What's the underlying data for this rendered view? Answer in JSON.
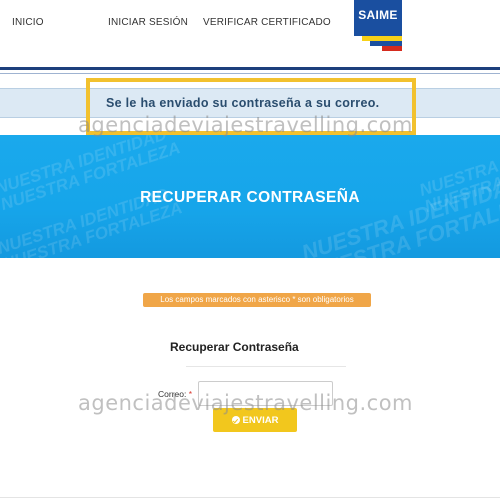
{
  "nav": {
    "home": "INICIO",
    "login": "INICIAR SESIÓN",
    "verify": "VERIFICAR CERTIFICADO"
  },
  "logo": {
    "text": "SAIME",
    "colors": [
      "#f7d117",
      "#1a4fa0",
      "#d52b1e"
    ]
  },
  "alert": {
    "message": "Se le ha enviado su contraseña a su correo.",
    "highlight_color": "#f2c12e"
  },
  "watermark": "agenciadeviajestravelling.com",
  "banner": {
    "title": "RECUPERAR CONTRASEÑA",
    "pattern_text": [
      "NUESTRA IDENTIDAD",
      "NUESTRA FORTALEZA"
    ],
    "color": "#1aa9ec"
  },
  "form": {
    "required_note": "Los campos marcados con asterisco * son obligatorios",
    "title": "Recuperar Contraseña",
    "email_label": "Correo:",
    "required_mark": "*",
    "email_value": "",
    "submit_label": "ENVIAR",
    "submit_icon": "check-circle-icon",
    "submit_color": "#f2c71d"
  }
}
